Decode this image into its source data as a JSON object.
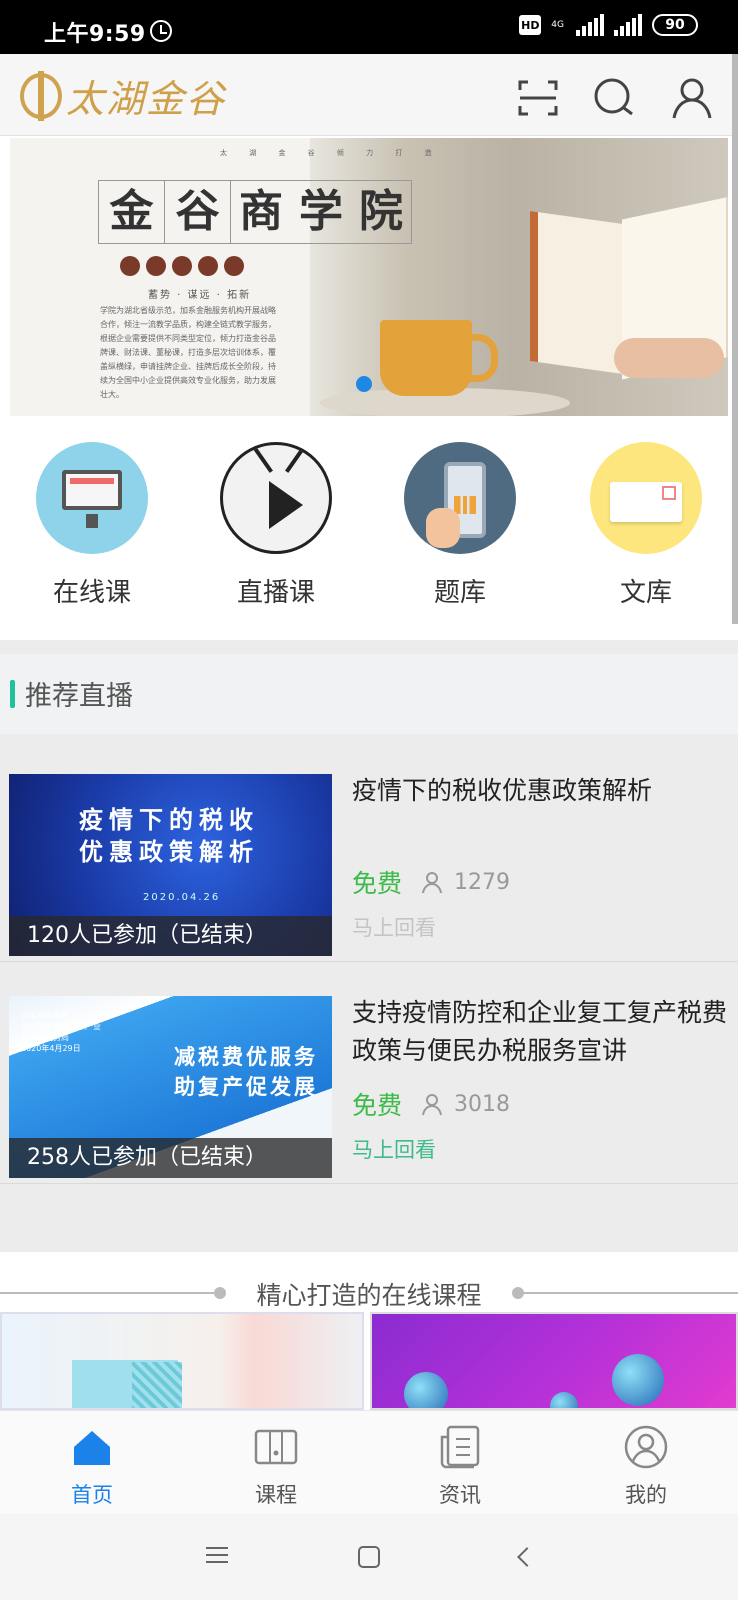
{
  "status_bar": {
    "time": "上午9:59",
    "hd": "HD",
    "network": "4G",
    "battery": "90"
  },
  "header": {
    "logo_text": "太湖金谷",
    "icons": [
      "scan-icon",
      "search-icon",
      "user-icon"
    ]
  },
  "banner": {
    "top_text": "太 湖 金 谷 倾 力 打 造",
    "title_chars": [
      "金",
      "谷",
      "商",
      "学",
      "院"
    ],
    "tags": "蓄势 · 谋远 · 拓新",
    "description": "学院为湖北省级示范，加系金融服务机构开展战略合作，倾注一流教学品质，构建全链式教学服务，根据企业需要提供不同类型定位，倾力打造金谷品牌课、财法课、董秘课，打造多层次培训体系，覆盖纵横绿，申请挂牌企业、挂牌后成长全阶段，持续为全国中小企业提供高效专业化服务，助力发展壮大。",
    "active_dot": 1
  },
  "categories": [
    {
      "label": "在线课",
      "icon": "monitor-icon"
    },
    {
      "label": "直播课",
      "icon": "tv-play-icon"
    },
    {
      "label": "题库",
      "icon": "phone-chart-icon"
    },
    {
      "label": "文库",
      "icon": "envelope-icon"
    }
  ],
  "recommended": {
    "title": "推荐直播",
    "items": [
      {
        "thumb_text": "疫情下的税收\n优惠政策解析",
        "thumb_date": "2020.04.26",
        "joined": "120人已参加（已结束）",
        "title": "疫情下的税收优惠政策解析",
        "price": "免费",
        "count": "1279",
        "replay": "马上回看",
        "replay_color": "#c4c4c4"
      },
      {
        "thumb_text": "减税费优服务\n助复产促发展",
        "thumb_small": "国家税务总局\n苏州国家高新技术产业\n开发区税务局\n2020年4月29日",
        "joined": "258人已参加（已结束）",
        "title": "支持疫情防控和企业复工复产税费政策与便民办税服务宣讲",
        "price": "免费",
        "count": "3018",
        "replay": "马上回看",
        "replay_color": "#3dbb8a"
      }
    ]
  },
  "courses": {
    "title": "精心打造的在线课程"
  },
  "bottom_nav": {
    "tabs": [
      {
        "label": "首页",
        "icon": "home-icon",
        "active": true
      },
      {
        "label": "课程",
        "icon": "course-icon",
        "active": false
      },
      {
        "label": "资讯",
        "icon": "news-icon",
        "active": false
      },
      {
        "label": "我的",
        "icon": "profile-icon",
        "active": false
      }
    ]
  },
  "colors": {
    "accent": "#1a82e8",
    "free_green": "#3dbb4a",
    "section_bar": "#1fc29b",
    "logo_gold": "#cf9f49"
  }
}
